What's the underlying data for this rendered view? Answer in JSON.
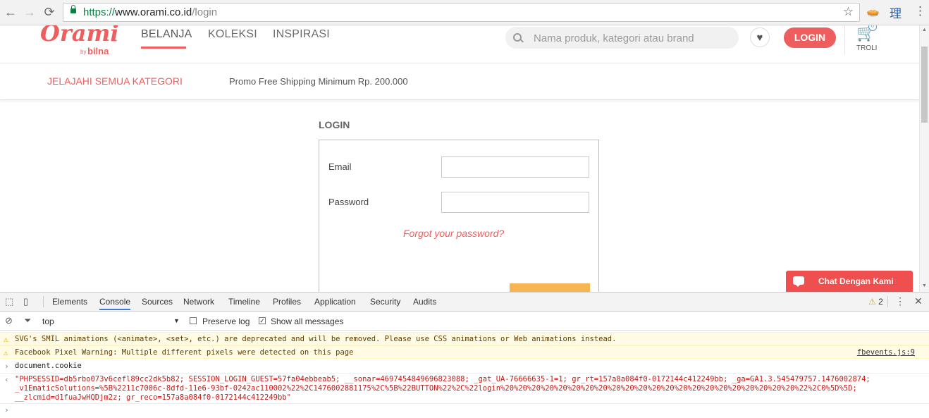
{
  "browser": {
    "url_scheme": "https://",
    "url_host": "www.orami.co.id",
    "url_path": "/login",
    "back_glyph": "←",
    "forward_glyph": "→",
    "reload_glyph": "⟳",
    "star_glyph": "☆",
    "ext_icon_1": "🥧",
    "ext_icon_2": "理",
    "menu_glyph": "⋮"
  },
  "site": {
    "logo": "Orami",
    "logo_by": "by",
    "logo_sub": "bilna",
    "nav": [
      {
        "label": "BELANJA",
        "active": true
      },
      {
        "label": "KOLEKSI",
        "active": false
      },
      {
        "label": "INSPIRASI",
        "active": false
      }
    ],
    "search_placeholder": "Nama produk, kategori atau brand",
    "heart_glyph": "♥",
    "login_label": "LOGIN",
    "cart_glyph": "🛒",
    "cart_count": "0",
    "cart_label": "TROLI",
    "category_link": "JELAJAHI SEMUA KATEGORI",
    "promo": "Promo Free Shipping Minimum Rp. 200.000"
  },
  "login_form": {
    "title": "LOGIN",
    "email_label": "Email",
    "email_value": "",
    "password_label": "Password",
    "password_value": "",
    "forgot_label": "Forgot your password?"
  },
  "chat": {
    "label": "Chat Dengan Kami"
  },
  "devtools": {
    "tabs": [
      "Elements",
      "Console",
      "Sources",
      "Network",
      "Timeline",
      "Profiles",
      "Application",
      "Security",
      "Audits"
    ],
    "active_tab": "Console",
    "warning_count": "2",
    "context": "top",
    "preserve_log_label": "Preserve log",
    "preserve_log_checked": false,
    "show_all_label": "Show all messages",
    "show_all_checked": true,
    "warnings": [
      {
        "text": "SVG's SMIL animations (<animate>, <set>, etc.) are deprecated and will be removed. Please use CSS animations or Web animations instead.",
        "source": ""
      },
      {
        "text": "Facebook Pixel Warning: Multiple different pixels were detected on this page",
        "source": "fbevents.js:9"
      }
    ],
    "command": "document.cookie",
    "result_lines": [
      "\"PHPSESSID=db5rbo073v6cefl89cc2dk5b82; SESSION_LOGIN_GUEST=57fa04ebbeab5; __sonar=4697454849696823088; _gat_UA-76666635-1=1; gr_rt=157a8a084f0-0172144c412249bb; _ga=GA1.3.545479757.1476002874;",
      "_v1EmaticSolutions=%5B%2211c7006c-8dfd-11e6-93bf-0242ac110002%22%2C1476002881175%2C%5B%22BUTTON%22%2C%22login%20%20%20%20%20%20%20%20%20%20%20%20%20%20%20%20%20%20%20%20%20%20%22%2C0%5D%5D;",
      "__zlcmid=d1fuaJwHQDjm2z; gr_reco=157a8a084f0-0172144c412249bb\""
    ]
  }
}
